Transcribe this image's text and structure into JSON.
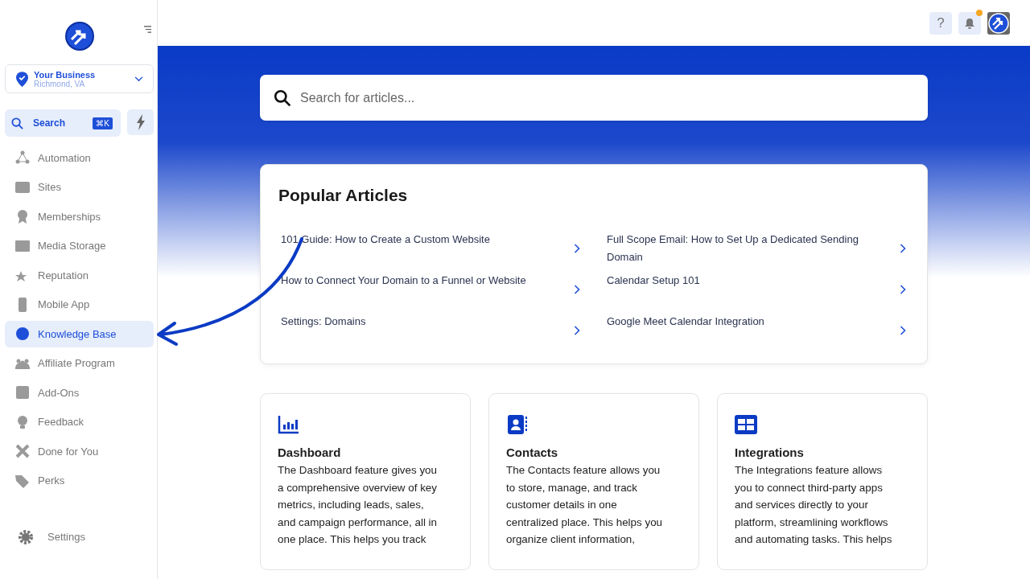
{
  "location": {
    "name": "Your Business",
    "city": "Richmond, VA"
  },
  "search": {
    "label": "Search",
    "shortcut": "⌘K"
  },
  "nav": [
    {
      "label": "Automation",
      "selected": false
    },
    {
      "label": "Sites",
      "selected": false
    },
    {
      "label": "Memberships",
      "selected": false
    },
    {
      "label": "Media Storage",
      "selected": false
    },
    {
      "label": "Reputation",
      "selected": false
    },
    {
      "label": "Mobile App",
      "selected": false
    },
    {
      "label": "Knowledge Base",
      "selected": true
    },
    {
      "label": "Affiliate Program",
      "selected": false
    },
    {
      "label": "Add-Ons",
      "selected": false
    },
    {
      "label": "Feedback",
      "selected": false
    },
    {
      "label": "Done for You",
      "selected": false
    },
    {
      "label": "Perks",
      "selected": false
    }
  ],
  "settings": "Settings",
  "topbar": {
    "help": "?",
    "notification_dot": true
  },
  "article_search": {
    "placeholder": "Search for articles..."
  },
  "popular": {
    "title": "Popular Articles",
    "articles": [
      {
        "title": "101 Guide: How to Create a Custom Website"
      },
      {
        "title": "Full Scope Email: How to Set Up a Dedicated Sending Domain"
      },
      {
        "title": "How to Connect Your Domain to a Funnel or Website"
      },
      {
        "title": "Calendar Setup 101"
      },
      {
        "title": "Settings: Domains"
      },
      {
        "title": "Google Meet Calendar Integration"
      }
    ]
  },
  "features": [
    {
      "title": "Dashboard",
      "description": "The Dashboard feature gives you a comprehensive overview of key metrics, including leads, sales, and campaign performance, all in one place. This helps you track"
    },
    {
      "title": "Contacts",
      "description": "The Contacts feature allows you to store, manage, and track customer details in one centralized place. This helps you organize client information,"
    },
    {
      "title": "Integrations",
      "description": "The Integrations feature allows you to connect third-party apps and services directly to your platform, streamlining workflows and automating tasks. This helps"
    }
  ]
}
